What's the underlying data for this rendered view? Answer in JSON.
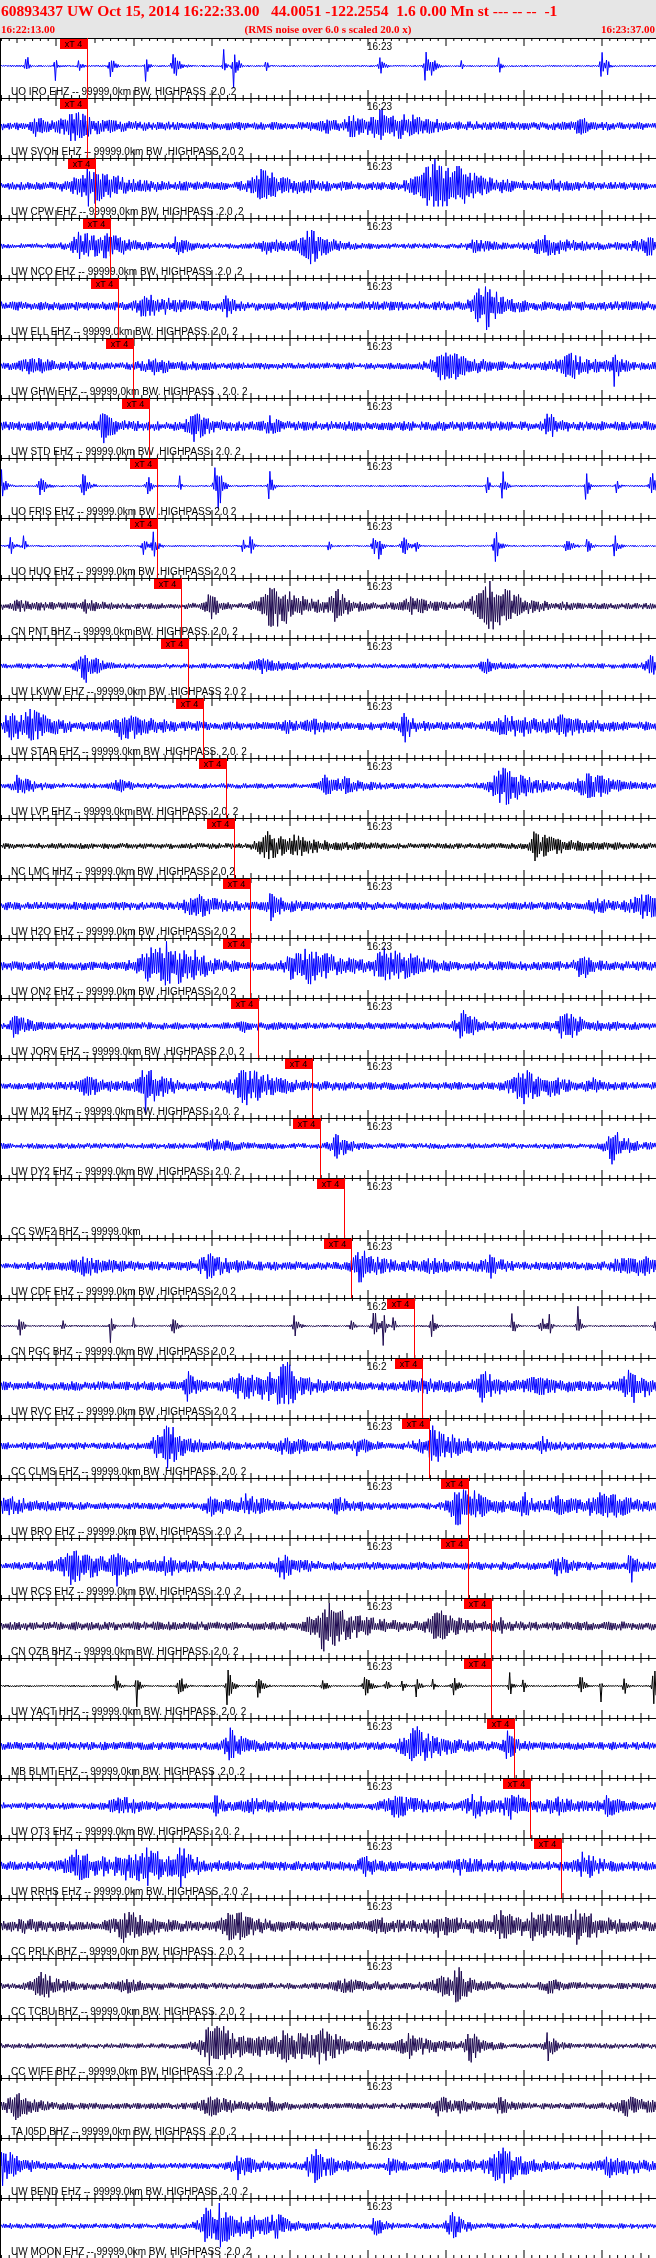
{
  "header": {
    "title": "60893437 UW Oct 15, 2014 16:22:33.00   44.0051 -122.2554  1.6 0.00 Mn st --- -- --  -1",
    "start_time": "16:22:13.00",
    "note": "(RMS noise over 6.0 s scaled 20.0 x)",
    "end_time": "16:23:37.00"
  },
  "channels": [
    {
      "label": "UO IRO EHZ -- 99999.0km BW. HIGHPASS .2.0 .2",
      "time_label": "16:23",
      "pick": {
        "text": "xT 4"
      },
      "trace": {
        "kind": "spikes",
        "color": "#0000ff"
      }
    },
    {
      "label": "UW SVOH EHZ -- 99999.0km BW .HIGHPASS 2.0 2",
      "time_label": "16:23",
      "pick": {
        "text": "xT 4"
      },
      "trace": {
        "kind": "noise",
        "color": "#0000ff"
      }
    },
    {
      "label": "UW CPW EHZ -- 99999.0km BW. HIGHPASS .2.0 .2",
      "time_label": "16:23",
      "pick": {
        "text": "xT 4"
      },
      "trace": {
        "kind": "noise",
        "color": "#0000ff"
      }
    },
    {
      "label": "UW NCO EHZ -- 99999.0km BW. HIGHPASS .2.0 .2",
      "time_label": "16:23",
      "pick": {
        "text": "xT 4"
      },
      "trace": {
        "kind": "noise",
        "color": "#0000ff"
      }
    },
    {
      "label": "UW ELL EHZ -- 99999.0km BW. HIGHPASS. 2.0. 2",
      "time_label": "16:23",
      "pick": {
        "text": "xT 4"
      },
      "trace": {
        "kind": "noise",
        "color": "#0000ff"
      }
    },
    {
      "label": "UW GHW EHZ -- 99999.0km BW. HIGHPASS . 2.0. 2",
      "time_label": "16:23",
      "pick": {
        "text": "xT 4"
      },
      "trace": {
        "kind": "noise",
        "color": "#0000ff"
      }
    },
    {
      "label": "UW STD EHZ -- 99999.0km BW .HIGHPASS. 2.0. 2",
      "time_label": "16:23",
      "pick": {
        "text": "xT 4"
      },
      "trace": {
        "kind": "noise",
        "color": "#0000ff"
      }
    },
    {
      "label": "UO FRIS EHZ -- 99999.0km BW .HIGHPASS 2.0 2",
      "time_label": "16:23",
      "pick": {
        "text": "xT 4"
      },
      "trace": {
        "kind": "spikes",
        "color": "#0000ff"
      }
    },
    {
      "label": "UO HUQ EHZ -- 99999.0km BW .HIGHPASS 2.0 2",
      "time_label": "16:23",
      "pick": {
        "text": "xT 4"
      },
      "trace": {
        "kind": "spikes",
        "color": "#0000ff"
      }
    },
    {
      "label": "CN PNT BHZ -- 99999.0km BW. HIGHPASS. 2.0. 2",
      "time_label": "16:23",
      "pick": {
        "text": "xT 4"
      },
      "trace": {
        "kind": "noise",
        "color": "#1e0a50"
      }
    },
    {
      "label": "UW LKWW EHZ -- 99999.0km BW .HIGHPASS 2.0 2",
      "time_label": "16:23",
      "pick": {
        "text": "xT 4"
      },
      "trace": {
        "kind": "noise",
        "color": "#0000ff"
      }
    },
    {
      "label": "UW STAR EHZ -- 99999.0km BW .HIGHPASS. 2.0. 2",
      "time_label": "16:23",
      "pick": {
        "text": "xT 4"
      },
      "trace": {
        "kind": "noise",
        "color": "#0000ff"
      }
    },
    {
      "label": "UW LVP EHZ -- 99999.0km BW. HIGHPASS. 2.0. 2",
      "time_label": "16:23",
      "pick": {
        "text": "xT 4"
      },
      "trace": {
        "kind": "noise",
        "color": "#0000ff"
      }
    },
    {
      "label": "NC LMC HHZ -- 99999.0km BW .HIGHPASS 2.0 2",
      "time_label": "16:23",
      "pick": {
        "text": "xT 4"
      },
      "trace": {
        "kind": "noise",
        "color": "#000000"
      }
    },
    {
      "label": "UW H2O EHZ -- 99999.0km BW .HIGHPASS 2.0 2",
      "time_label": "16:23",
      "pick": {
        "text": "xT 4"
      },
      "trace": {
        "kind": "noise",
        "color": "#0000ff"
      }
    },
    {
      "label": "UW ON2 EHZ -- 99999.0km BW .HIGHPASS 2.0 2",
      "time_label": "16:23",
      "pick": {
        "text": "xT 4"
      },
      "trace": {
        "kind": "noise",
        "color": "#0000ff"
      }
    },
    {
      "label": "UW JORV EHZ -- 99999.0km BW .HIGHPASS 2.0. 2",
      "time_label": "16:23",
      "pick": {
        "text": "xT 4"
      },
      "trace": {
        "kind": "noise",
        "color": "#0000ff"
      }
    },
    {
      "label": "UW MJ2 EHZ -- 99999.0km BW. HIGHPASS. 2.0. 2",
      "time_label": "16:23",
      "pick": {
        "text": "xT 4"
      },
      "trace": {
        "kind": "noise",
        "color": "#0000ff"
      }
    },
    {
      "label": "UW DY2 EHZ -- 99999.0km BW .HIGHPASS. 2.0. 2",
      "time_label": "16:23",
      "pick": {
        "text": "xT 4"
      },
      "trace": {
        "kind": "noise",
        "color": "#0000ff"
      }
    },
    {
      "label": "CC SWF2 BHZ -- 99999.0km",
      "time_label": "16:23",
      "pick": {
        "text": "xT 4"
      }
    },
    {
      "label": "UW CDF EHZ -- 99999.0km BW .HIGHPASS 2.0 2",
      "time_label": "16:23",
      "pick": {
        "text": "xT 4"
      },
      "trace": {
        "kind": "noise",
        "color": "#0000ff"
      }
    },
    {
      "label": "CN PGC BHZ -- 99999.0km BW .HIGHPASS 2.0 2",
      "time_label": "16:2",
      "pick": {
        "text": "xT 4"
      },
      "trace": {
        "kind": "spikes",
        "color": "#1e0a50"
      }
    },
    {
      "label": "UW RVC EHZ -- 99999.0km BW .HIGHPASS 2.0 2",
      "time_label": "16:2",
      "pick": {
        "text": "xT 4"
      },
      "trace": {
        "kind": "noise",
        "color": "#0000ff"
      }
    },
    {
      "label": "CC CLMS EHZ -- 99999.0km BW .HIGHPASS. 2.0. 2",
      "time_label": "16:23",
      "pick": {
        "text": "xT 4"
      },
      "trace": {
        "kind": "noise",
        "color": "#0000ff"
      }
    },
    {
      "label": "UW BRO EHZ -- 99999.0km BW. HIGHPASS .2.0 .2",
      "time_label": "16:23",
      "pick": {
        "text": "xT 4"
      },
      "trace": {
        "kind": "noise",
        "color": "#0000ff"
      }
    },
    {
      "label": "UW RCS EHZ -- 99999.0km BW. HIGHPASS .2.0 .2",
      "time_label": "16:23",
      "pick": {
        "text": "xT 4"
      },
      "trace": {
        "kind": "noise",
        "color": "#0000ff"
      }
    },
    {
      "label": "CN OZB BHZ -- 99999.0km BW. HIGHPASS. 2.0. 2",
      "time_label": "16:23",
      "pick": {
        "text": "xT 4"
      },
      "trace": {
        "kind": "noise",
        "color": "#1e0a50"
      }
    },
    {
      "label": "UW YACT HHZ -- 99999.0km BW. HIGHPASS. 2.0. 2",
      "time_label": "16:23",
      "pick": {
        "text": "xT 4"
      },
      "trace": {
        "kind": "spikes",
        "color": "#000000"
      }
    },
    {
      "label": "MB BLMT EHZ -- 99999.0km BW. HIGHPASS .2.0 .2",
      "time_label": "16:23",
      "pick": {
        "text": "xT 4"
      },
      "trace": {
        "kind": "noise",
        "color": "#0000ff"
      }
    },
    {
      "label": "UW OT3 EHZ -- 99999.0km BW. HIGHPASS. 2.0. 2",
      "time_label": "16:23",
      "pick": {
        "text": "xT 4"
      },
      "trace": {
        "kind": "noise",
        "color": "#0000ff"
      }
    },
    {
      "label": "UW RRHS EHZ -- 99999.0km BW. HIGHPASS .2.0 .2",
      "time_label": "16:23",
      "pick": {
        "text": "xT 4"
      },
      "trace": {
        "kind": "noise",
        "color": "#0000ff"
      }
    },
    {
      "label": "CC PRLK BHZ -- 99999.0km BW. HIGHPASS. 2.0. 2",
      "time_label": "16:23",
      "trace": {
        "kind": "noise",
        "color": "#1e0a50"
      }
    },
    {
      "label": "CC TCBU BHZ -- 99999.0km BW. HIGHPASS. 2.0. 2",
      "time_label": "16:23",
      "trace": {
        "kind": "noise",
        "color": "#1e0a50"
      }
    },
    {
      "label": "CC WIFE BHZ -- 99999.0km BW. HIGHPASS .2.0 .2",
      "time_label": "16:23",
      "trace": {
        "kind": "noise",
        "color": "#1e0a50"
      }
    },
    {
      "label": "TA I05D BHZ -- 99999.0km BW. HIGHPASS .2.0 .2",
      "time_label": "16:23",
      "trace": {
        "kind": "noise",
        "color": "#1e0a50"
      }
    },
    {
      "label": "UW BEND EHZ -- 99999.0km BW. HIGHPASS .2.0 .2",
      "time_label": "16:23",
      "trace": {
        "kind": "noise",
        "color": "#0000ff"
      }
    },
    {
      "label": "UW MOON EHZ -- 99999.0km BW. HIGHPASS .2.0 .2",
      "time_label": "16:23",
      "trace": {
        "kind": "noise",
        "color": "#0000ff"
      }
    }
  ]
}
